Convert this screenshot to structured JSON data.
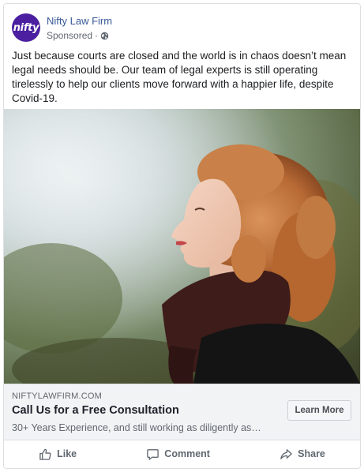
{
  "post": {
    "page_name": "Nifty Law Firm",
    "avatar_text": "nifty",
    "sponsored_label": "Sponsored",
    "separator": "·",
    "text": "Just because courts are closed and the world is in chaos doesn’t mean legal needs should be. Our team of legal experts is still operating tirelessly to help our clients move forward with a happier life, despite Covid-19."
  },
  "link": {
    "domain": "NIFTYLAWFIRM.COM",
    "headline": "Call Us for a Free Consultation",
    "description": "30+ Years Experience, and still working as diligently as…",
    "cta_label": "Learn More"
  },
  "actions": {
    "like": "Like",
    "comment": "Comment",
    "share": "Share"
  },
  "icons": {
    "privacy": "globe-icon",
    "like": "thumbs-up-icon",
    "comment": "speech-bubble-icon",
    "share": "share-arrow-icon"
  },
  "colors": {
    "brand": "#4b1fa0",
    "link": "#385898",
    "secondary_text": "#606770"
  }
}
